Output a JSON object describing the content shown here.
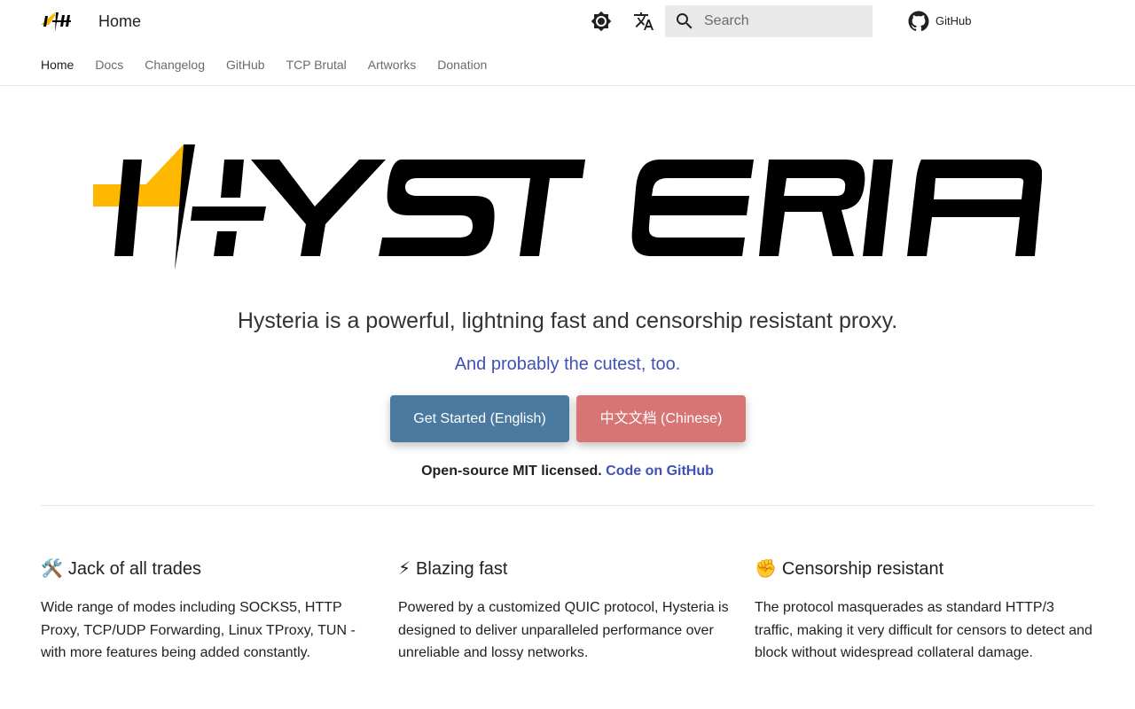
{
  "header": {
    "site_title": "Home",
    "theme_icon": "brightness-icon",
    "language_icon": "translate-icon",
    "search": {
      "placeholder": "Search",
      "value": "",
      "icon": "search-icon"
    },
    "source": {
      "label": "GitHub",
      "icon": "github-icon"
    },
    "tabs": [
      {
        "label": "Home",
        "active": true
      },
      {
        "label": "Docs",
        "active": false
      },
      {
        "label": "Changelog",
        "active": false
      },
      {
        "label": "GitHub",
        "active": false
      },
      {
        "label": "TCP Brutal",
        "active": false
      },
      {
        "label": "Artworks",
        "active": false
      },
      {
        "label": "Donation",
        "active": false
      }
    ]
  },
  "hero": {
    "logo_text": "HYSTERIA",
    "tagline": "Hysteria is a powerful, lightning fast and censorship resistant proxy.",
    "subtagline": "And probably the cutest, too.",
    "primary_button": "Get Started (English)",
    "secondary_button": "中文文档 (Chinese)",
    "license_text": "Open-source MIT licensed.",
    "license_link": "Code on GitHub"
  },
  "features": [
    {
      "emoji": "🛠️",
      "title": "Jack of all trades",
      "text": "Wide range of modes including SOCKS5, HTTP Proxy, TCP/UDP Forwarding, Linux TProxy, TUN - with more features being added constantly."
    },
    {
      "emoji": "⚡",
      "title": "Blazing fast",
      "text": "Powered by a customized QUIC protocol, Hysteria is designed to deliver unparalleled performance over unreliable and lossy networks."
    },
    {
      "emoji": "✊",
      "title": "Censorship resistant",
      "text": "The protocol masquerades as standard HTTP/3 traffic, making it very difficult for censors to detect and block without widespread collateral damage."
    }
  ],
  "colors": {
    "accent": "#3f51b5",
    "primary_button": "#4a7a9f",
    "secondary_button": "#d77474",
    "logo_yellow": "#ffb800",
    "logo_black": "#000000"
  }
}
